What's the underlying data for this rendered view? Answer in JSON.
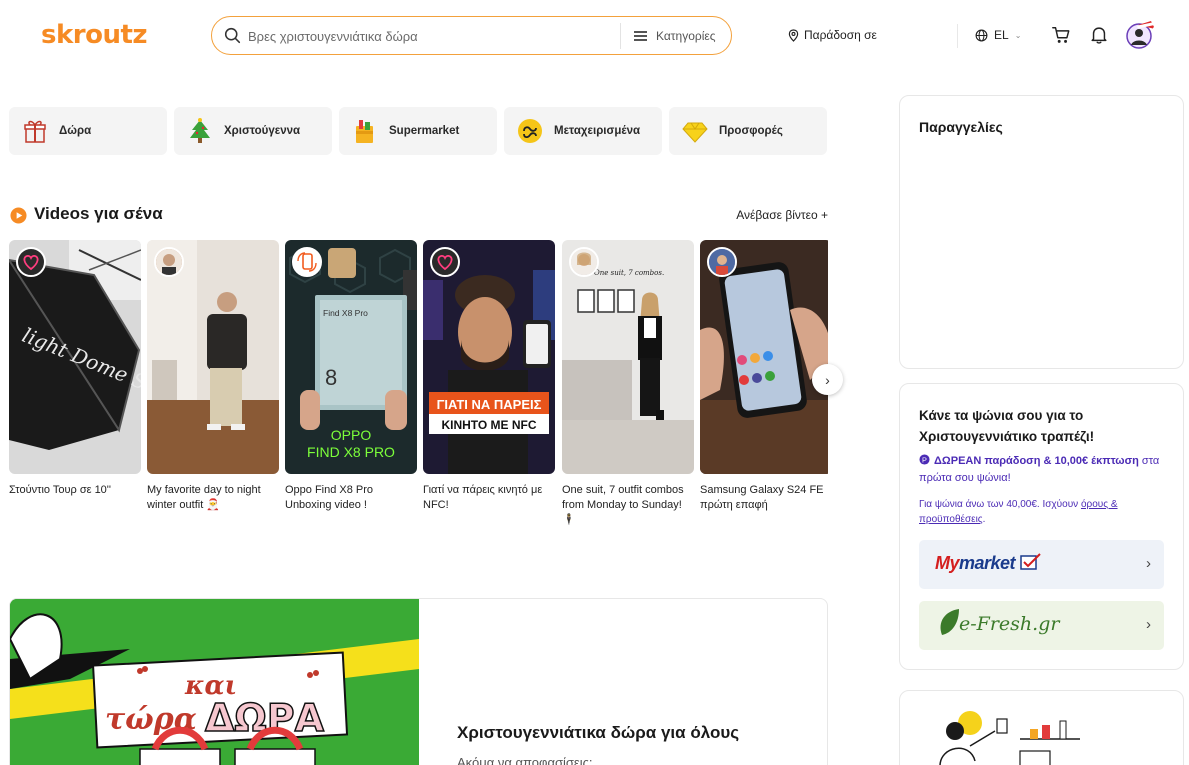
{
  "header": {
    "logo": "skroutz",
    "search_placeholder": "Βρες χριστουγεννιάτικα δώρα",
    "categories_label": "Κατηγορίες",
    "delivery_label": "Παράδοση σε",
    "language": "EL"
  },
  "pills": [
    {
      "label": "Δώρα",
      "icon": "gift-icon"
    },
    {
      "label": "Χριστούγεννα",
      "icon": "christmas-tree-icon"
    },
    {
      "label": "Supermarket",
      "icon": "grocery-bag-icon"
    },
    {
      "label": "Μεταχειρισμένα",
      "icon": "recycle-icon"
    },
    {
      "label": "Προσφορές",
      "icon": "diamond-icon"
    }
  ],
  "videos": {
    "title": "Videos για σένα",
    "upload_label": "Ανέβασε βίντεο +",
    "items": [
      {
        "caption": "Στούντιο Τουρ σε 10''",
        "overlay": "light Dome SE"
      },
      {
        "caption": "My favorite day to night winter outfit 🎅",
        "overlay": ""
      },
      {
        "caption": "Oppo Find X8 Pro Unboxing video !",
        "overlay": "OPPO FIND X8 PRO",
        "box_label": "Find X8 Pro",
        "box_number": "8"
      },
      {
        "caption": "Γιατί να πάρεις κινητό με NFC!",
        "overlay": "ΓΙΑΤΙ ΝΑ ΠΑΡΕΙΣ ΚΙΝΗΤΟ ΜΕ NFC"
      },
      {
        "caption": "One suit, 7 outfit combos from Monday to Sunday!🕴️",
        "overlay": "One suit, 7 combos."
      },
      {
        "caption": "Samsung Galaxy S24 FE πρώτη επαφή",
        "overlay": ""
      }
    ]
  },
  "promo": {
    "banner_text_1": "και",
    "banner_text_2": "τώρα",
    "banner_text_3": "ΔΩΡΑ",
    "title": "Χριστουγεννιάτικα δώρα για όλους",
    "subtitle": "Ακόμα να αποφασίσεις;"
  },
  "sidebar": {
    "orders_title": "Παραγγελίες",
    "xmas_title": "Κάνε τα ψώνια σου για το Χριστουγεννιάτικο τραπέζι!",
    "offer_bold": "ΔΩΡΕΑΝ παράδοση & 10,00€ έκπτωση",
    "offer_rest": " στα πρώτα σου ψώνια!",
    "terms_prefix": "Για ψώνια άνω των 40,00€. Ισχύουν ",
    "terms_link": "όρους & προϋποθέσεις",
    "terms_suffix": ".",
    "shops": [
      {
        "name_part1": "My",
        "name_part2": "market"
      },
      {
        "name": "e-Fresh.gr"
      }
    ]
  },
  "colors": {
    "brand": "#f68b24",
    "offer_purple": "#4b2bb5",
    "promo_green": "#3aaa35"
  }
}
